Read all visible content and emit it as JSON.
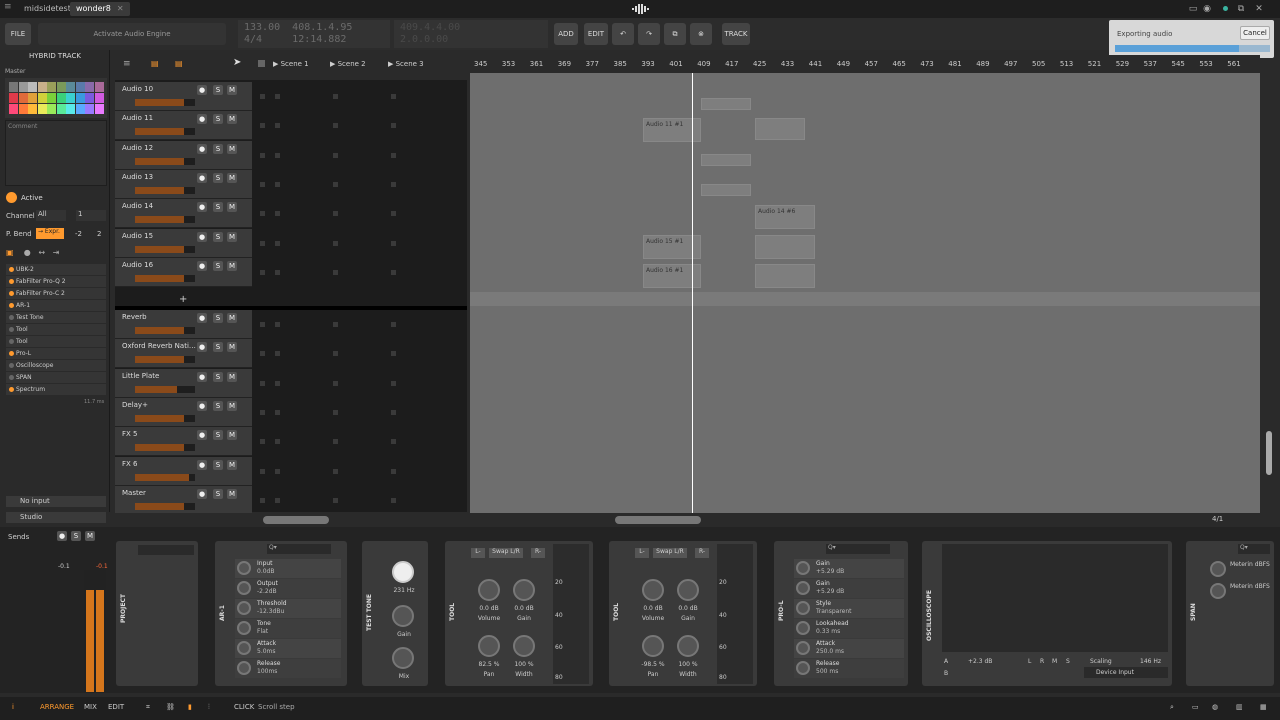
{
  "title_bar": {
    "tabs": [
      {
        "label": "midsidetest *"
      },
      {
        "label": "wonder8"
      }
    ]
  },
  "toolbar": {
    "file_label": "FILE",
    "activate_label": "Activate Audio Engine",
    "transport_pos1": "133.00",
    "transport_pos2": "408.1.4.95",
    "transport_sig": "4/4",
    "transport_time": "12:14.882",
    "transport_right1": "409.4.4.00",
    "transport_right2": "2.0.0.00",
    "add_label": "ADD",
    "edit_label": "EDIT",
    "track_label": "TRACK"
  },
  "export": {
    "label": "Exporting audio",
    "cancel_label": "Cancel",
    "progress": 0.8
  },
  "inspector": {
    "header": "HYBRID TRACK",
    "master_label": "Master",
    "comment_label": "Comment",
    "active_label": "Active",
    "channel_label": "Channel",
    "channel_value": "All",
    "channel_num": "1",
    "pbend_label": "P. Bend",
    "pbend_value": "→ Expr.",
    "pbend_low": "-2",
    "pbend_high": "2",
    "devices": [
      {
        "label": "UBK-2",
        "active": true
      },
      {
        "label": "FabFilter Pro-Q 2",
        "active": true
      },
      {
        "label": "FabFilter Pro-C 2",
        "active": true
      },
      {
        "label": "AR-1",
        "active": true
      },
      {
        "label": "Test Tone",
        "active": false
      },
      {
        "label": "Tool",
        "active": false
      },
      {
        "label": "Tool",
        "active": false
      },
      {
        "label": "Pro-L",
        "active": true
      },
      {
        "label": "Oscilloscope",
        "active": false
      },
      {
        "label": "SPAN",
        "active": false
      },
      {
        "label": "Spectrum",
        "active": true
      }
    ],
    "latency": "11.7 ms",
    "input_label": "No input",
    "output_label": "Studio",
    "sends_label": "Sends",
    "meter_left": "-0.1",
    "meter_right": "-0.1"
  },
  "scenes": [
    "Scene 1",
    "Scene 2",
    "Scene 3"
  ],
  "tracks": [
    {
      "name": "Audio 10",
      "level": 0.82
    },
    {
      "name": "Audio 11",
      "level": 0.82
    },
    {
      "name": "Audio 12",
      "level": 0.82
    },
    {
      "name": "Audio 13",
      "level": 0.82
    },
    {
      "name": "Audio 14",
      "level": 0.82
    },
    {
      "name": "Audio 15",
      "level": 0.82
    },
    {
      "name": "Audio 16",
      "level": 0.82
    }
  ],
  "fx_tracks": [
    {
      "name": "Reverb",
      "level": 0.82
    },
    {
      "name": "Oxford Reverb Nati…",
      "level": 0.82
    },
    {
      "name": "Little Plate",
      "level": 0.7
    },
    {
      "name": "Delay+",
      "level": 0.82
    },
    {
      "name": "FX 5",
      "level": 0.82
    },
    {
      "name": "FX 6",
      "level": 0.9
    },
    {
      "name": "Master",
      "level": 0.82
    }
  ],
  "ruler": [
    "345",
    "353",
    "361",
    "369",
    "377",
    "385",
    "393",
    "401",
    "409",
    "417",
    "425",
    "433",
    "441",
    "449",
    "457",
    "465",
    "473",
    "481",
    "489",
    "497",
    "505",
    "513",
    "521",
    "529",
    "537",
    "545",
    "553",
    "561"
  ],
  "clips": [
    {
      "label": "Audio 11 #1"
    },
    {
      "label": "Audio 14 #6"
    },
    {
      "label": "Audio 15 #1"
    },
    {
      "label": "Audio 16 #1"
    }
  ],
  "arranger_zoom": "4/1",
  "devices": {
    "project_label": "PROJECT",
    "ar1": {
      "label": "AR-1",
      "search": "Q▾",
      "params": [
        {
          "name": "Input",
          "value": "0.0dB"
        },
        {
          "name": "Output",
          "value": "-2.2dB"
        },
        {
          "name": "Threshold",
          "value": "-12.3dBu"
        },
        {
          "name": "Tone",
          "value": "Flat"
        },
        {
          "name": "Attack",
          "value": "5.0ms"
        },
        {
          "name": "Release",
          "value": "100ms"
        }
      ]
    },
    "testtone": {
      "label": "TEST TONE",
      "freq": "231 Hz",
      "gain": "Gain",
      "mix": "Mix"
    },
    "tool1": {
      "label": "TOOL",
      "swap": "Swap L/R",
      "l": "L-",
      "r": "R-",
      "vol_val": "0.0 dB",
      "vol": "Volume",
      "gain_val": "0.0 dB",
      "gain": "Gain",
      "pan_val": "82.5 %",
      "pan": "Pan",
      "width_val": "100 %",
      "width": "Width"
    },
    "tool2": {
      "label": "TOOL",
      "swap": "Swap L/R",
      "l": "L-",
      "r": "R-",
      "vol_val": "0.0 dB",
      "vol": "Volume",
      "gain_val": "0.0 dB",
      "gain": "Gain",
      "pan_val": "-98.5 %",
      "pan": "Pan",
      "width_val": "100 %",
      "width": "Width"
    },
    "db_scale": [
      "20",
      "40",
      "60",
      "80"
    ],
    "prol": {
      "label": "PRO-L",
      "search": "Q▾",
      "params": [
        {
          "name": "Gain",
          "value": "+5.29 dB"
        },
        {
          "name": "Gain",
          "value": "+5.29 dB"
        },
        {
          "name": "Style",
          "value": "Transparent"
        },
        {
          "name": "Lookahead",
          "value": "0.33 ms"
        },
        {
          "name": "Attack",
          "value": "250.0 ms"
        },
        {
          "name": "Release",
          "value": "500 ms"
        }
      ]
    },
    "scope": {
      "label": "OSCILLOSCOPE",
      "gain": "+2.3 dB",
      "scaling": "Scaling",
      "hz": "146 Hz",
      "device_input": "Device Input",
      "a": "A",
      "b": "B",
      "l": "L",
      "r": "R",
      "m": "M",
      "s": "S"
    },
    "span": {
      "label": "SPAN",
      "p1": "Meterin dBFS",
      "p2": "Meterin dBFS",
      "search": "Q▾"
    }
  },
  "statusbar": {
    "arrange": "ARRANGE",
    "mix": "MIX",
    "edit": "EDIT",
    "click": "CLICK",
    "scroll": "Scroll step"
  },
  "colors": {
    "accent": "#ff9a2e",
    "playhead": "#ffffff",
    "export_bar": "#5aa0d8"
  }
}
